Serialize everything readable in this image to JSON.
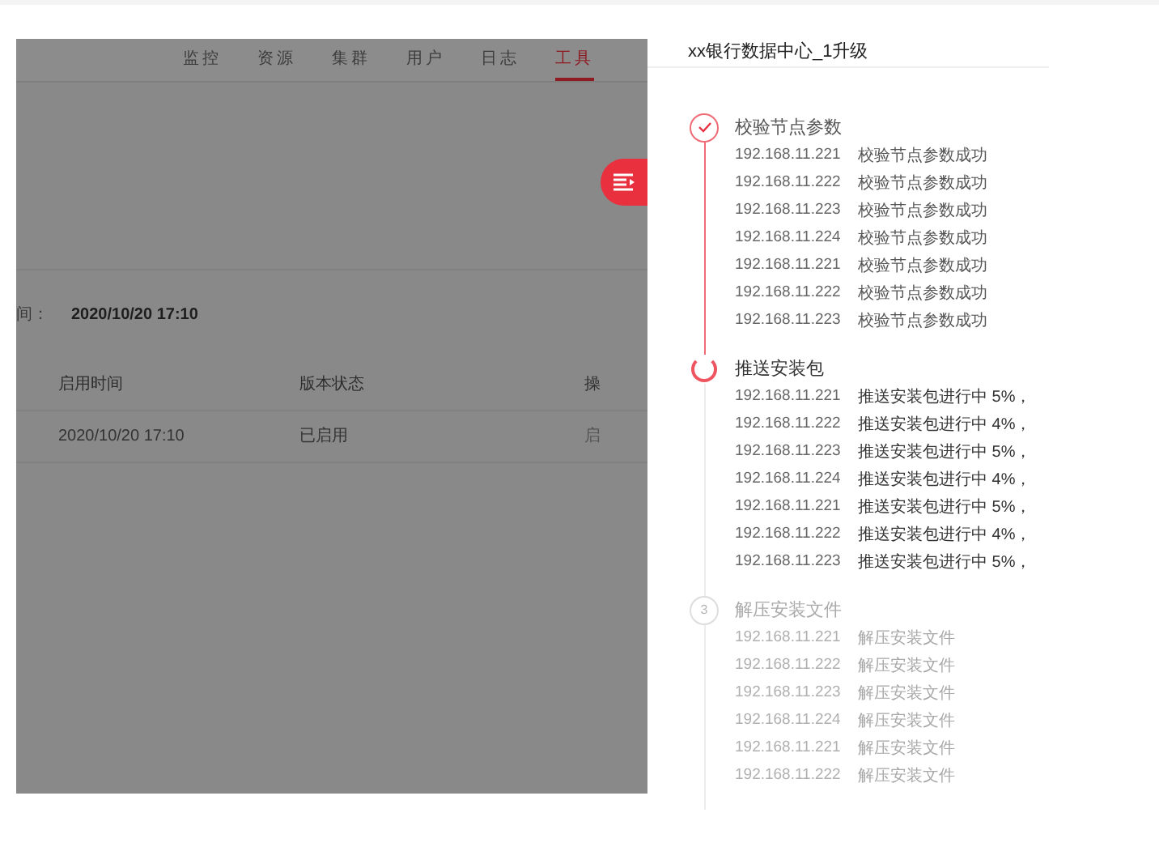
{
  "nav": {
    "tabs": [
      {
        "label": "监控",
        "selected": false
      },
      {
        "label": "资源",
        "selected": false
      },
      {
        "label": "集群",
        "selected": false
      },
      {
        "label": "用户",
        "selected": false
      },
      {
        "label": "日志",
        "selected": false
      },
      {
        "label": "工具",
        "selected": true
      }
    ]
  },
  "info": {
    "label": "间：",
    "value": "2020/10/20 17:10"
  },
  "table": {
    "columns": [
      "启用时间",
      "版本状态",
      "操"
    ],
    "rows": [
      [
        "2020/10/20 17:10",
        "已启用",
        "启"
      ]
    ]
  },
  "drawer": {
    "title": "xx银行数据中心_1升级",
    "steps": [
      {
        "title": "校验节点参数",
        "kind": "done",
        "rows": [
          {
            "ip": "192.168.11.221",
            "message": "校验节点参数成功"
          },
          {
            "ip": "192.168.11.222",
            "message": "校验节点参数成功"
          },
          {
            "ip": "192.168.11.223",
            "message": "校验节点参数成功"
          },
          {
            "ip": "192.168.11.224",
            "message": "校验节点参数成功"
          },
          {
            "ip": "192.168.11.221",
            "message": "校验节点参数成功"
          },
          {
            "ip": "192.168.11.222",
            "message": "校验节点参数成功"
          },
          {
            "ip": "192.168.11.223",
            "message": "校验节点参数成功"
          }
        ]
      },
      {
        "title": "推送安装包",
        "kind": "active",
        "rows": [
          {
            "ip": "192.168.11.221",
            "message": "推送安装包进行中 5%，"
          },
          {
            "ip": "192.168.11.222",
            "message": "推送安装包进行中 4%，"
          },
          {
            "ip": "192.168.11.223",
            "message": "推送安装包进行中 5%，"
          },
          {
            "ip": "192.168.11.224",
            "message": "推送安装包进行中 4%，"
          },
          {
            "ip": "192.168.11.221",
            "message": "推送安装包进行中 5%，"
          },
          {
            "ip": "192.168.11.222",
            "message": "推送安装包进行中 4%，"
          },
          {
            "ip": "192.168.11.223",
            "message": "推送安装包进行中 5%，"
          }
        ]
      },
      {
        "title": "解压安装文件",
        "kind": "pending",
        "number": "3",
        "rows": [
          {
            "ip": "192.168.11.221",
            "message": "解压安装文件"
          },
          {
            "ip": "192.168.11.222",
            "message": "解压安装文件"
          },
          {
            "ip": "192.168.11.223",
            "message": "解压安装文件"
          },
          {
            "ip": "192.168.11.224",
            "message": "解压安装文件"
          },
          {
            "ip": "192.168.11.221",
            "message": "解压安装文件"
          },
          {
            "ip": "192.168.11.222",
            "message": "解压安装文件"
          }
        ]
      }
    ]
  }
}
